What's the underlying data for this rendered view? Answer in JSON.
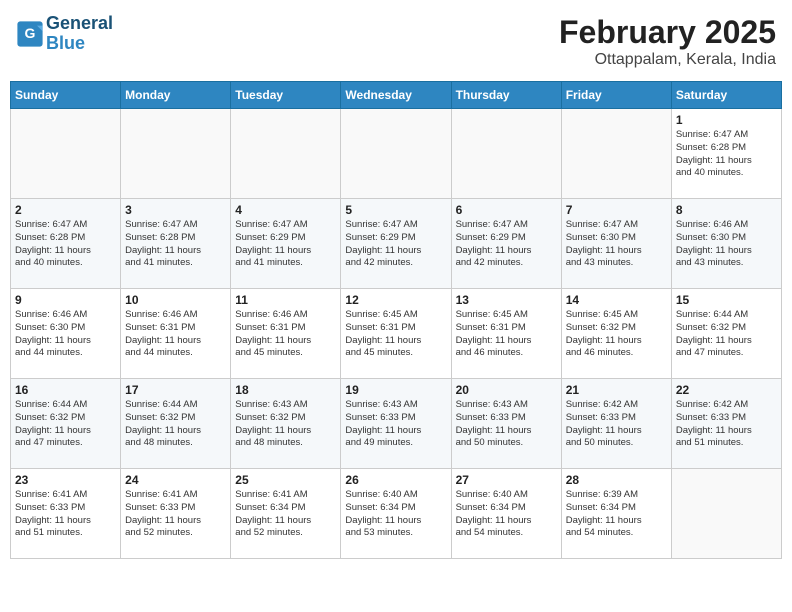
{
  "logo": {
    "line1": "General",
    "line2": "Blue"
  },
  "title": "February 2025",
  "subtitle": "Ottappalam, Kerala, India",
  "weekdays": [
    "Sunday",
    "Monday",
    "Tuesday",
    "Wednesday",
    "Thursday",
    "Friday",
    "Saturday"
  ],
  "weeks": [
    [
      {
        "day": "",
        "info": ""
      },
      {
        "day": "",
        "info": ""
      },
      {
        "day": "",
        "info": ""
      },
      {
        "day": "",
        "info": ""
      },
      {
        "day": "",
        "info": ""
      },
      {
        "day": "",
        "info": ""
      },
      {
        "day": "1",
        "info": "Sunrise: 6:47 AM\nSunset: 6:28 PM\nDaylight: 11 hours\nand 40 minutes."
      }
    ],
    [
      {
        "day": "2",
        "info": "Sunrise: 6:47 AM\nSunset: 6:28 PM\nDaylight: 11 hours\nand 40 minutes."
      },
      {
        "day": "3",
        "info": "Sunrise: 6:47 AM\nSunset: 6:28 PM\nDaylight: 11 hours\nand 41 minutes."
      },
      {
        "day": "4",
        "info": "Sunrise: 6:47 AM\nSunset: 6:29 PM\nDaylight: 11 hours\nand 41 minutes."
      },
      {
        "day": "5",
        "info": "Sunrise: 6:47 AM\nSunset: 6:29 PM\nDaylight: 11 hours\nand 42 minutes."
      },
      {
        "day": "6",
        "info": "Sunrise: 6:47 AM\nSunset: 6:29 PM\nDaylight: 11 hours\nand 42 minutes."
      },
      {
        "day": "7",
        "info": "Sunrise: 6:47 AM\nSunset: 6:30 PM\nDaylight: 11 hours\nand 43 minutes."
      },
      {
        "day": "8",
        "info": "Sunrise: 6:46 AM\nSunset: 6:30 PM\nDaylight: 11 hours\nand 43 minutes."
      }
    ],
    [
      {
        "day": "9",
        "info": "Sunrise: 6:46 AM\nSunset: 6:30 PM\nDaylight: 11 hours\nand 44 minutes."
      },
      {
        "day": "10",
        "info": "Sunrise: 6:46 AM\nSunset: 6:31 PM\nDaylight: 11 hours\nand 44 minutes."
      },
      {
        "day": "11",
        "info": "Sunrise: 6:46 AM\nSunset: 6:31 PM\nDaylight: 11 hours\nand 45 minutes."
      },
      {
        "day": "12",
        "info": "Sunrise: 6:45 AM\nSunset: 6:31 PM\nDaylight: 11 hours\nand 45 minutes."
      },
      {
        "day": "13",
        "info": "Sunrise: 6:45 AM\nSunset: 6:31 PM\nDaylight: 11 hours\nand 46 minutes."
      },
      {
        "day": "14",
        "info": "Sunrise: 6:45 AM\nSunset: 6:32 PM\nDaylight: 11 hours\nand 46 minutes."
      },
      {
        "day": "15",
        "info": "Sunrise: 6:44 AM\nSunset: 6:32 PM\nDaylight: 11 hours\nand 47 minutes."
      }
    ],
    [
      {
        "day": "16",
        "info": "Sunrise: 6:44 AM\nSunset: 6:32 PM\nDaylight: 11 hours\nand 47 minutes."
      },
      {
        "day": "17",
        "info": "Sunrise: 6:44 AM\nSunset: 6:32 PM\nDaylight: 11 hours\nand 48 minutes."
      },
      {
        "day": "18",
        "info": "Sunrise: 6:43 AM\nSunset: 6:32 PM\nDaylight: 11 hours\nand 48 minutes."
      },
      {
        "day": "19",
        "info": "Sunrise: 6:43 AM\nSunset: 6:33 PM\nDaylight: 11 hours\nand 49 minutes."
      },
      {
        "day": "20",
        "info": "Sunrise: 6:43 AM\nSunset: 6:33 PM\nDaylight: 11 hours\nand 50 minutes."
      },
      {
        "day": "21",
        "info": "Sunrise: 6:42 AM\nSunset: 6:33 PM\nDaylight: 11 hours\nand 50 minutes."
      },
      {
        "day": "22",
        "info": "Sunrise: 6:42 AM\nSunset: 6:33 PM\nDaylight: 11 hours\nand 51 minutes."
      }
    ],
    [
      {
        "day": "23",
        "info": "Sunrise: 6:41 AM\nSunset: 6:33 PM\nDaylight: 11 hours\nand 51 minutes."
      },
      {
        "day": "24",
        "info": "Sunrise: 6:41 AM\nSunset: 6:33 PM\nDaylight: 11 hours\nand 52 minutes."
      },
      {
        "day": "25",
        "info": "Sunrise: 6:41 AM\nSunset: 6:34 PM\nDaylight: 11 hours\nand 52 minutes."
      },
      {
        "day": "26",
        "info": "Sunrise: 6:40 AM\nSunset: 6:34 PM\nDaylight: 11 hours\nand 53 minutes."
      },
      {
        "day": "27",
        "info": "Sunrise: 6:40 AM\nSunset: 6:34 PM\nDaylight: 11 hours\nand 54 minutes."
      },
      {
        "day": "28",
        "info": "Sunrise: 6:39 AM\nSunset: 6:34 PM\nDaylight: 11 hours\nand 54 minutes."
      },
      {
        "day": "",
        "info": ""
      }
    ]
  ]
}
